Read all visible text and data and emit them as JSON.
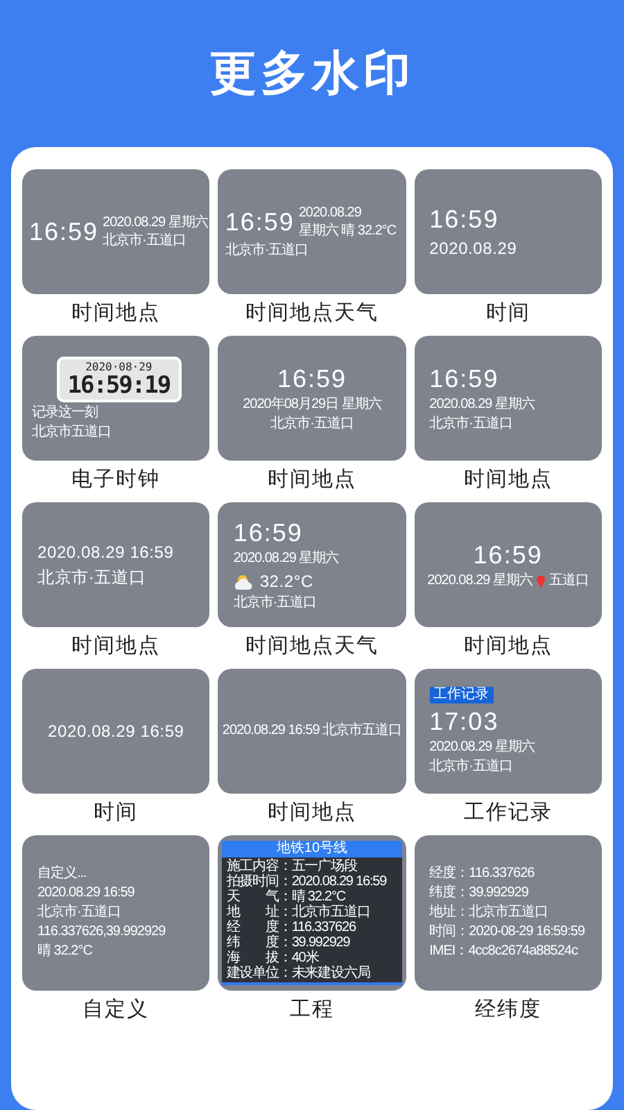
{
  "title": "更多水印",
  "templates": [
    {
      "label": "时间地点",
      "preview": {
        "kind": "inline",
        "time": "16:59",
        "side": [
          "2020.08.29 星期六",
          "北京市·五道口"
        ]
      }
    },
    {
      "label": "时间地点天气",
      "preview": {
        "kind": "inline",
        "time": "16:59",
        "side": [
          "2020.08.29",
          "星期六 晴 32.2°C"
        ],
        "below": [
          "北京市·五道口"
        ]
      }
    },
    {
      "label": "时间",
      "preview": {
        "kind": "stack-left",
        "lines": [
          {
            "kind": "big",
            "text": "16:59"
          },
          {
            "kind": "mid",
            "text": "2020.08.29"
          }
        ]
      }
    },
    {
      "label": "电子时钟",
      "preview": {
        "kind": "lcd",
        "date": "2020·08·29",
        "clock": "16:59:19",
        "lines": [
          "记录这一刻",
          "北京市五道口"
        ]
      }
    },
    {
      "label": "时间地点",
      "preview": {
        "kind": "stack-center",
        "lines": [
          {
            "kind": "big",
            "text": "16:59"
          },
          {
            "kind": "small",
            "text": "2020年08月29日 星期六"
          },
          {
            "kind": "small",
            "text": "北京市·五道口"
          }
        ]
      }
    },
    {
      "label": "时间地点",
      "preview": {
        "kind": "stack-left",
        "lines": [
          {
            "kind": "big",
            "text": "16:59"
          },
          {
            "kind": "small",
            "text": "2020.08.29 星期六"
          },
          {
            "kind": "small",
            "text": "北京市·五道口"
          }
        ]
      }
    },
    {
      "label": "时间地点",
      "preview": {
        "kind": "stack-left",
        "lines": [
          {
            "kind": "mid",
            "text": "2020.08.29 16:59"
          },
          {
            "kind": "mid",
            "text": "北京市·五道口"
          }
        ]
      }
    },
    {
      "label": "时间地点天气",
      "preview": {
        "kind": "stack-left",
        "lines": [
          {
            "kind": "big",
            "text": "16:59"
          },
          {
            "kind": "small",
            "text": "2020.08.29 星期六"
          },
          {
            "kind": "weather",
            "text": "32.2°C"
          },
          {
            "kind": "small",
            "text": "北京市·五道口"
          }
        ]
      }
    },
    {
      "label": "时间地点",
      "preview": {
        "kind": "stack-center",
        "lines": [
          {
            "kind": "big",
            "text": "16:59"
          },
          {
            "kind": "pin",
            "text": "2020.08.29 星期六",
            "place": "五道口"
          }
        ]
      }
    },
    {
      "label": "时间",
      "preview": {
        "kind": "stack-center",
        "lines": [
          {
            "kind": "mid",
            "text": "2020.08.29 16:59"
          }
        ]
      }
    },
    {
      "label": "时间地点",
      "preview": {
        "kind": "stack-center",
        "lines": [
          {
            "kind": "small",
            "text": "2020.08.29 16:59 北京市五道口"
          }
        ]
      }
    },
    {
      "label": "工作记录",
      "preview": {
        "kind": "stack-left",
        "lines": [
          {
            "kind": "badge",
            "text": "工作记录"
          },
          {
            "kind": "big",
            "text": "17:03"
          },
          {
            "kind": "small",
            "text": "2020.08.29 星期六"
          },
          {
            "kind": "small",
            "text": "北京市·五道口"
          }
        ]
      }
    },
    {
      "label": "自定义",
      "preview": {
        "kind": "stack-left",
        "lines": [
          {
            "kind": "small",
            "text": "自定义..."
          },
          {
            "kind": "small",
            "text": "2020.08.29 16:59"
          },
          {
            "kind": "small",
            "text": "北京市·五道口"
          },
          {
            "kind": "small",
            "text": "116.337626,39.992929"
          },
          {
            "kind": "small",
            "text": "晴 32.2°C"
          }
        ]
      }
    },
    {
      "label": "工程",
      "preview": {
        "kind": "panel",
        "title": "地铁10号线",
        "rows": [
          {
            "label": "施工内容：",
            "value": "五一广场段"
          },
          {
            "label": "拍摄时间：",
            "value": "2020.08.29 16:59"
          },
          {
            "label": "天　　气：",
            "value": "晴 32.2°C"
          },
          {
            "label": "地　　址：",
            "value": "北京市五道口"
          },
          {
            "label": "经　　度：",
            "value": "116.337626"
          },
          {
            "label": "纬　　度：",
            "value": "39.992929"
          },
          {
            "label": "海　　拔：",
            "value": "40米"
          },
          {
            "label": "建设单位：",
            "value": "未来建设六局"
          }
        ]
      }
    },
    {
      "label": "经纬度",
      "preview": {
        "kind": "stack-left",
        "lines": [
          {
            "kind": "small",
            "text": "经度：116.337626"
          },
          {
            "kind": "small",
            "text": "纬度：39.992929"
          },
          {
            "kind": "small",
            "text": "地址：北京市五道口"
          },
          {
            "kind": "small",
            "text": "时间：2020-08-29 16:59:59"
          },
          {
            "kind": "small",
            "text": "IMEI：4cc8c2674a88524c"
          }
        ]
      }
    }
  ]
}
